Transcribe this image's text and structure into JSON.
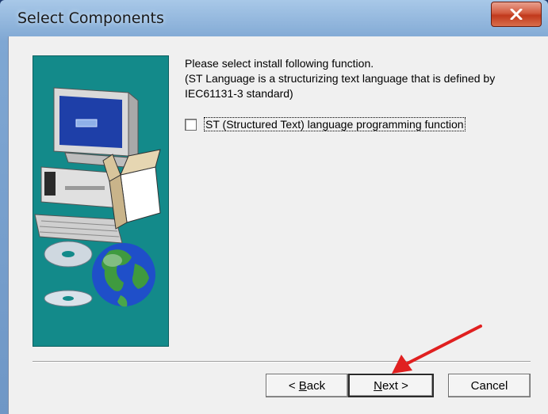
{
  "window": {
    "title": "Select Components",
    "close_icon": "close-icon"
  },
  "prompt": {
    "line1": "Please select install following function.",
    "line2": "(ST Language is a structurizing text language that is defined by",
    "line3": "IEC61131-3 standard)"
  },
  "option": {
    "label": "ST (Structured Text) language programming function",
    "checked": false
  },
  "buttons": {
    "back_prefix": "< ",
    "back_mnemonic": "B",
    "back_rest": "ack",
    "next_mnemonic": "N",
    "next_rest": "ext >",
    "cancel": "Cancel"
  },
  "annotation": {
    "arrow_color": "#e02020"
  },
  "colors": {
    "art_background": "#138a8a",
    "dialog_background": "#f0f0f0"
  }
}
